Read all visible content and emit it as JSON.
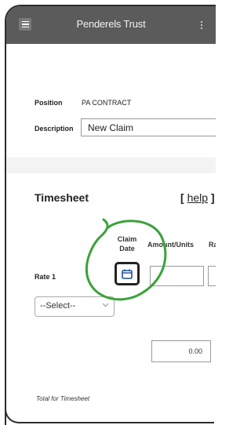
{
  "header": {
    "brand": "Penderels Trust",
    "menu_icon": "hamburger-menu-icon",
    "more_icon": "kebab-menu-icon"
  },
  "details": {
    "position_label": "Position",
    "position_value": "PA CONTRACT",
    "description_label": "Description",
    "description_value": "New Claim"
  },
  "timesheet": {
    "title": "Timesheet",
    "help_open": "[ ",
    "help_link": "help",
    "help_close": " ]",
    "col_claim_date_1": "Claim",
    "col_claim_date_2": "Date",
    "col_amount": "Amount/Units",
    "col_rate": "Ra",
    "rate_label": "Rate 1",
    "select_value": "--Select--",
    "total_value": "0.00",
    "total_label": "Total for Timesheet"
  },
  "colors": {
    "topbar": "#5b5b5b",
    "annotation_green": "#3aa23a"
  }
}
